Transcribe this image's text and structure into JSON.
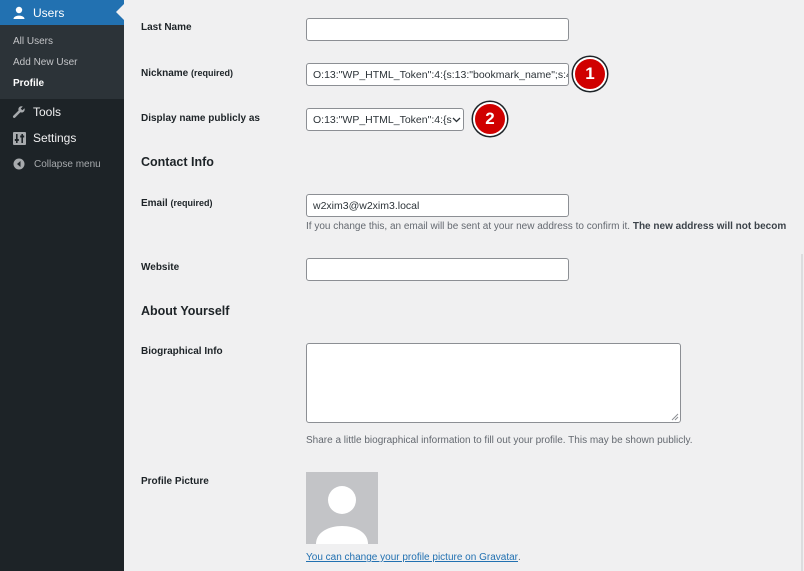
{
  "sidebar": {
    "users": {
      "label": "Users"
    },
    "submenu": {
      "all_users": "All Users",
      "add_new_user": "Add New User",
      "profile": "Profile"
    },
    "tools": {
      "label": "Tools"
    },
    "settings": {
      "label": "Settings"
    },
    "collapse": {
      "label": "Collapse menu"
    }
  },
  "form": {
    "last_name": {
      "label": "Last Name",
      "value": ""
    },
    "nickname": {
      "label": "Nickname",
      "required": "(required)",
      "value": "O:13:\"WP_HTML_Token\":4:{s:13:\"bookmark_name\";s:4"
    },
    "display_name": {
      "label": "Display name publicly as",
      "selected": "O:13:\"WP_HTML_Token\":4:{s"
    },
    "contact_heading": "Contact Info",
    "email": {
      "label": "Email",
      "required": "(required)",
      "value": "w2xim3@w2xim3.local",
      "description": "If you change this, an email will be sent at your new address to confirm it.",
      "description_bold": "The new address will not becom"
    },
    "website": {
      "label": "Website",
      "value": ""
    },
    "about_heading": "About Yourself",
    "bio": {
      "label": "Biographical Info",
      "value": "",
      "description": "Share a little biographical information to fill out your profile. This may be shown publicly."
    },
    "profile_picture": {
      "label": "Profile Picture",
      "link_text": "You can change your profile picture on Gravatar",
      "link_suffix": "."
    }
  },
  "markers": {
    "one": "1",
    "two": "2"
  },
  "colors": {
    "sidebar_bg": "#1d2327",
    "active_menu": "#2271b1",
    "marker": "#d00000",
    "link": "#2271b1"
  }
}
